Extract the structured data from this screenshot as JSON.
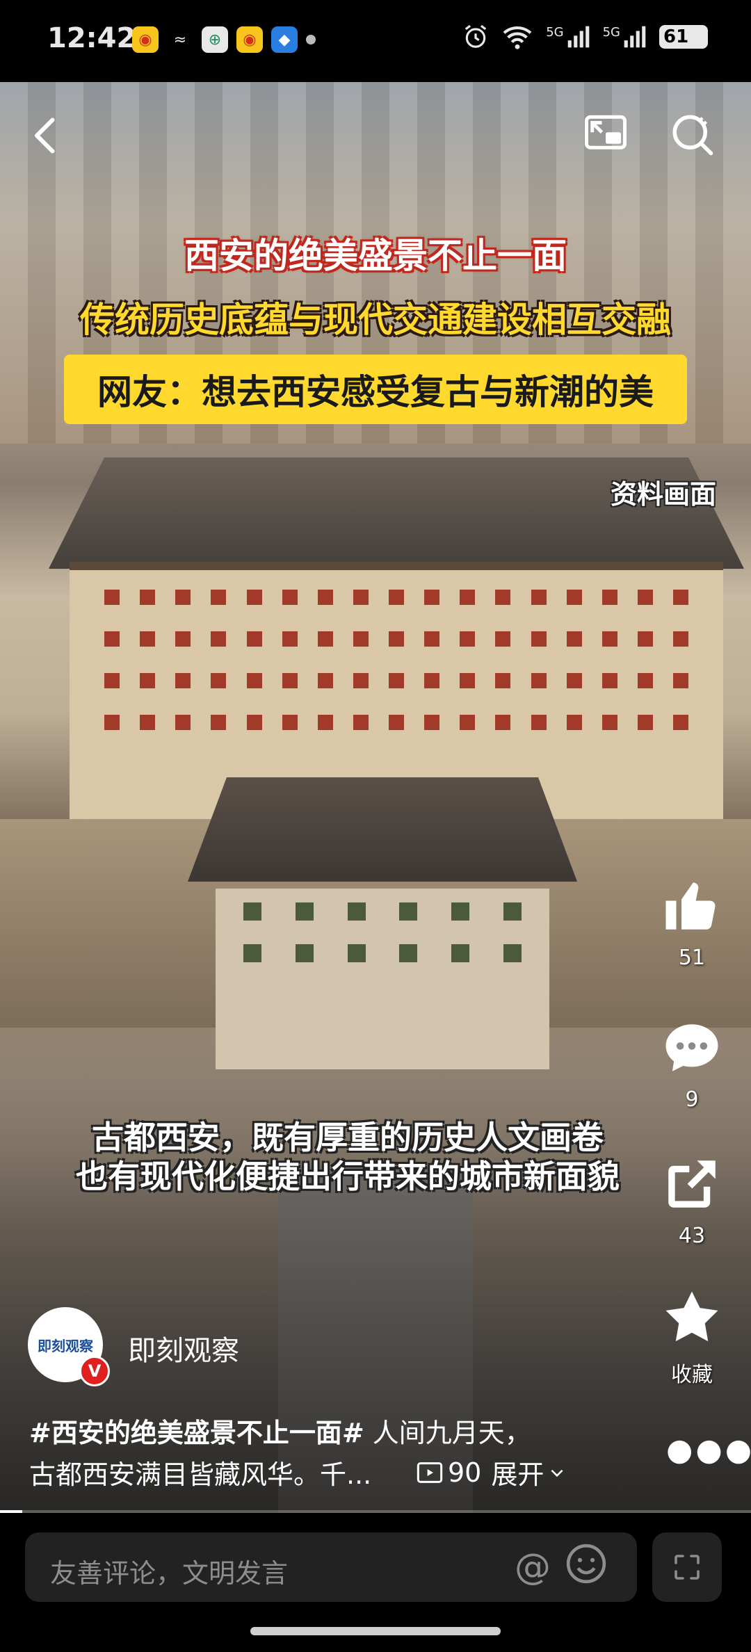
{
  "status_bar": {
    "time": "12:42",
    "battery": "61",
    "network_1": "5G",
    "network_2": "5G",
    "icons": [
      "weibo-icon",
      "link-icon",
      "bank-icon",
      "weibo-icon",
      "browser-icon",
      "dot-icon",
      "alarm-icon",
      "wifi-icon",
      "signal-icon",
      "signal-icon",
      "battery-icon"
    ]
  },
  "video": {
    "headline_1": "西安的绝美盛景不止一面",
    "headline_2": "传统历史底蕴与现代交通建设相互交融",
    "headline_3": "网友：想去西安感受复古与新潮的美",
    "archive_label": "资料画面",
    "caption_line_1": "古都西安，既有厚重的历史人文画卷",
    "caption_line_2": "也有现代化便捷出行带来的城市新面貌",
    "progress_fraction": 0.03
  },
  "actions": {
    "like_count": "51",
    "comment_count": "9",
    "share_count": "43",
    "favorite_label": "收藏"
  },
  "author": {
    "name": "即刻观察",
    "avatar_text": "即刻观察",
    "verified_mark": "V"
  },
  "description": {
    "hashtag": "#西安的绝美盛景不止一面#",
    "line1_rest": " 人间九月天，",
    "line2": "古都西安满目皆藏风华。千...",
    "play_count": "90",
    "expand_label": "展开"
  },
  "comment_bar": {
    "placeholder": "友善评论，文明发言",
    "at_symbol": "@"
  },
  "colors": {
    "accent_red": "#c0281e",
    "accent_yellow": "#ffd92e",
    "verified_red": "#e02020"
  }
}
